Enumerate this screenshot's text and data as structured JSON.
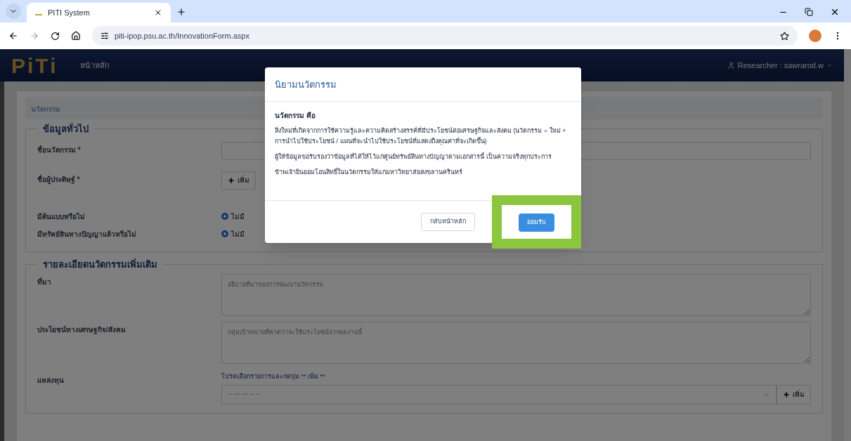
{
  "browser": {
    "tab_title": "PITI System",
    "url": "piti-ipop.psu.ac.th/InnovationForm.aspx"
  },
  "navbar": {
    "logo": "PiTi",
    "home": "หน้าหลัก",
    "user": "Researcher : sawrarod.w"
  },
  "breadcrumb": "นวัตกรรม",
  "general": {
    "legend": "ข้อมูลทั่วไป",
    "name_label": "ชื่อนวัตกรรม *",
    "inventor_label": "ชื่อผู้ประดิษฐ์ *",
    "add_button": "เพิ่ม",
    "radio_rows": [
      {
        "label": "มีต้นแบบหรือไม่",
        "options": [
          {
            "label": "ไม่มี",
            "selected": true
          }
        ]
      },
      {
        "label": "มีทรัพย์สินทางปัญญาแล้วหรือไม่",
        "options": [
          {
            "label": "ไม่มี",
            "selected": true
          }
        ]
      }
    ]
  },
  "details": {
    "legend": "รายละเอียดนวัตกรรมเพิ่มเติม",
    "textareas": [
      {
        "label": "ที่มา",
        "placeholder": "อธิบายที่มาของการพัฒนานวัตกรรม"
      },
      {
        "label": "ประโยชน์ทางเศรษฐกิจ/สังคม",
        "placeholder": "กลุ่มเป้าหมายที่คาดว่าจะใช้ประโยชน์จากผลงานนี้"
      }
    ],
    "funding": {
      "label": "แหล่งทุน",
      "hint": "โปรดเลือกรายการและกดปุ่ม ** เพิ่ม **",
      "select_value": "-- --- --- -- --",
      "add_button": "เพิ่ม"
    }
  },
  "modal": {
    "title": "นิยามนวัตกรรม",
    "heading": "นวัตกรรม คือ",
    "paragraphs": [
      "สิ่งใหม่ที่เกิดจากการใช้ความรู้และความคิดสร้างสรรค์ที่มีประโยชน์ต่อเศรษฐกิจและสังคม (นวัตกรรม = ใหม่ + การนำไปใช้ประโยชน์ / แผนที่จะนำไปใช้ประโยชน์ที่แสดงถึงคุณค่าที่จะเกิดขึ้น)",
      "ผู้ให้ข้อมูลขอรับรองว่าข้อมูลที่ได้ให้ไว้แก่ศูนย์ทรัพย์สินทางปัญญาตามเอกสารนี้ เป็นความจริงทุกประการ",
      "ข้าพเจ้ายินยอมโอนสิทธิ์ในนวัตกรรมให้แก่มหาวิทยาลัยสงขลานครินทร์"
    ],
    "back_button": "กลับหน้าหลัก",
    "accept_button": "ยอมรับ",
    "accept_highlighted": true
  }
}
